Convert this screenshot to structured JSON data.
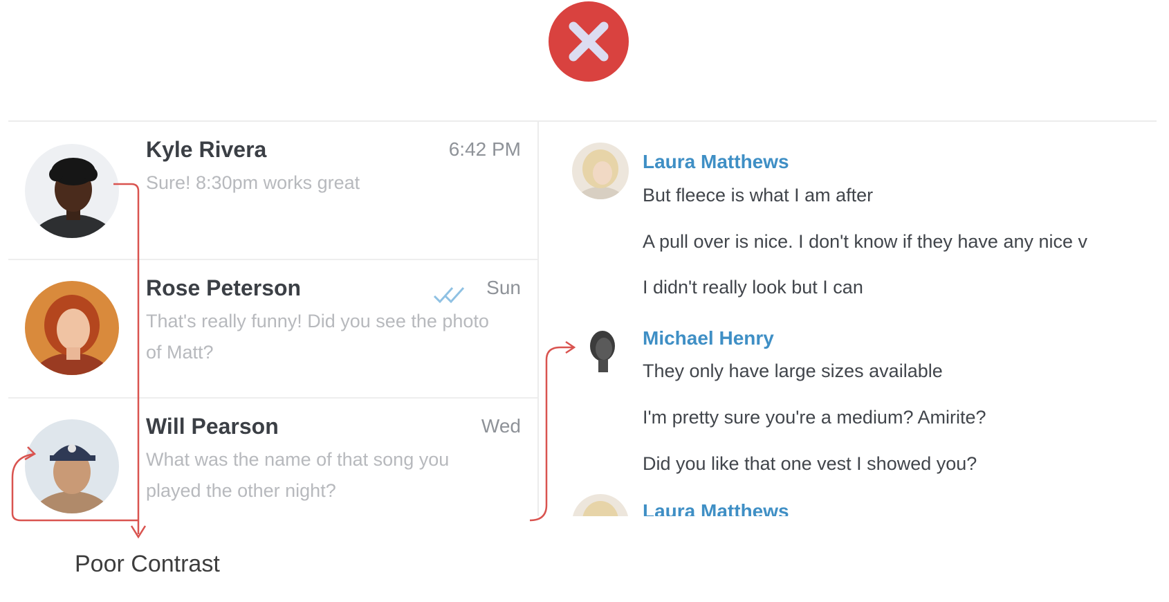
{
  "status_icon": "close-icon",
  "colors": {
    "error_badge": "#d9423f",
    "sender_name": "#3f8fc5",
    "annotation_line": "#d9534f",
    "preview_text": "#b7b9bd"
  },
  "conversations": [
    {
      "name": "Kyle Rivera",
      "time": "6:42 PM",
      "preview": "Sure! 8:30pm works great",
      "read_receipt": false
    },
    {
      "name": "Rose Peterson",
      "time": "Sun",
      "preview": "That's really funny! Did you see the photo of Matt?",
      "read_receipt": true
    },
    {
      "name": "Will Pearson",
      "time": "Wed",
      "preview": "What was the name of that song you played the other night?",
      "read_receipt": false
    }
  ],
  "chat": {
    "groups": [
      {
        "sender": "Laura Matthews",
        "messages": [
          "But fleece is what I am after",
          "A pull over is nice. I don't know if they have any nice v",
          "I didn't really look but I can"
        ]
      },
      {
        "sender": "Michael Henry",
        "messages": [
          "They only have large sizes available",
          "I'm pretty sure you're a medium? Amirite?",
          "Did you like that one vest I showed you?"
        ]
      },
      {
        "sender": "Laura Matthews",
        "messages": []
      }
    ]
  },
  "annotation": {
    "label": "Poor Contrast"
  }
}
